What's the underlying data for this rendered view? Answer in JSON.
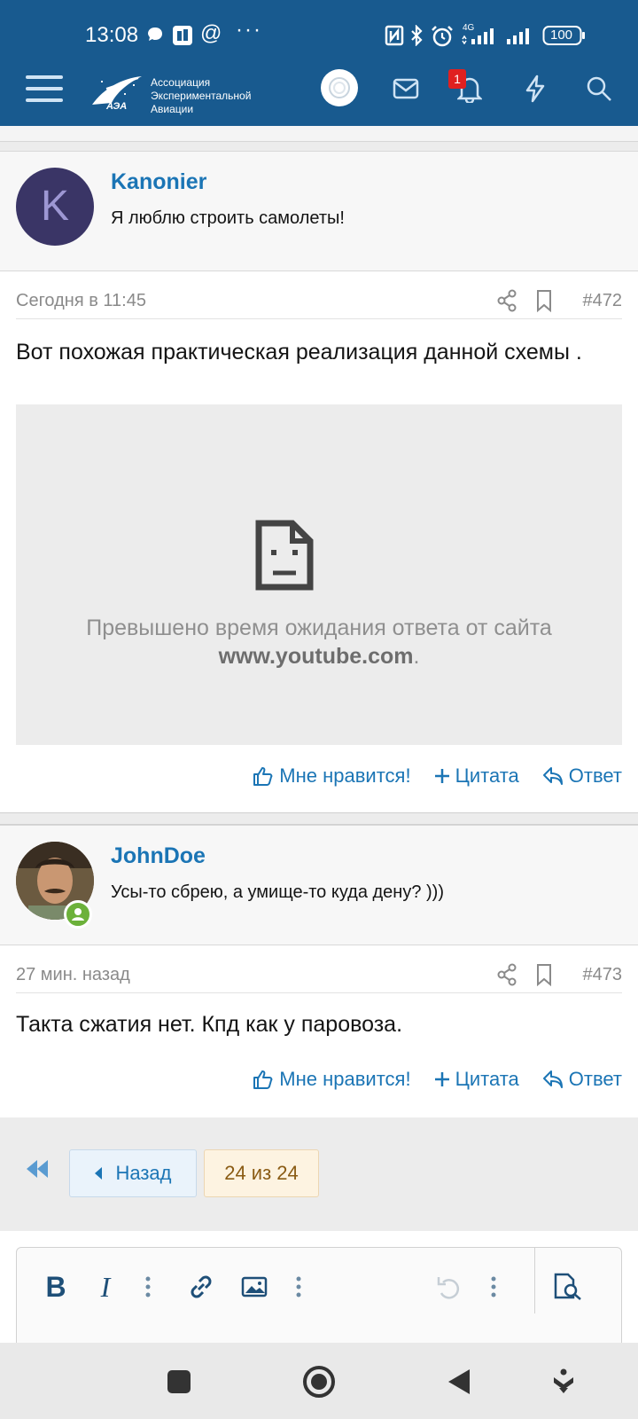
{
  "status_bar": {
    "time": "13:08",
    "network": "4G",
    "battery": "100"
  },
  "header": {
    "logo_line1": "Ассоциация",
    "logo_line2": "Экспериментальной",
    "logo_line3": "Авиации",
    "logo_mark": "АЭА",
    "notification_count": "1"
  },
  "posts": [
    {
      "author": "Kanonier",
      "author_title": "Я люблю строить самолеты!",
      "avatar_letter": "K",
      "date": "Сегодня в 11:45",
      "number": "#472",
      "text": "Вот похожая практическая реализация данной схемы .",
      "embed_error_line1": "Превышено время ожидания ответа от сайта",
      "embed_error_site": "www.youtube.com",
      "embed_error_tail": "."
    },
    {
      "author": "JohnDoe",
      "author_title": "Усы-то сбрею, а умище-то куда дену? )))",
      "date": "27 мин. назад",
      "number": "#473",
      "text": "Такта сжатия нет. Кпд как у паровоза."
    }
  ],
  "actions": {
    "like": "Мне нравится!",
    "quote": "Цитата",
    "reply": "Ответ"
  },
  "pager": {
    "back": "Назад",
    "current": "24 из 24"
  },
  "editor": {
    "bold": "B",
    "italic": "I"
  }
}
